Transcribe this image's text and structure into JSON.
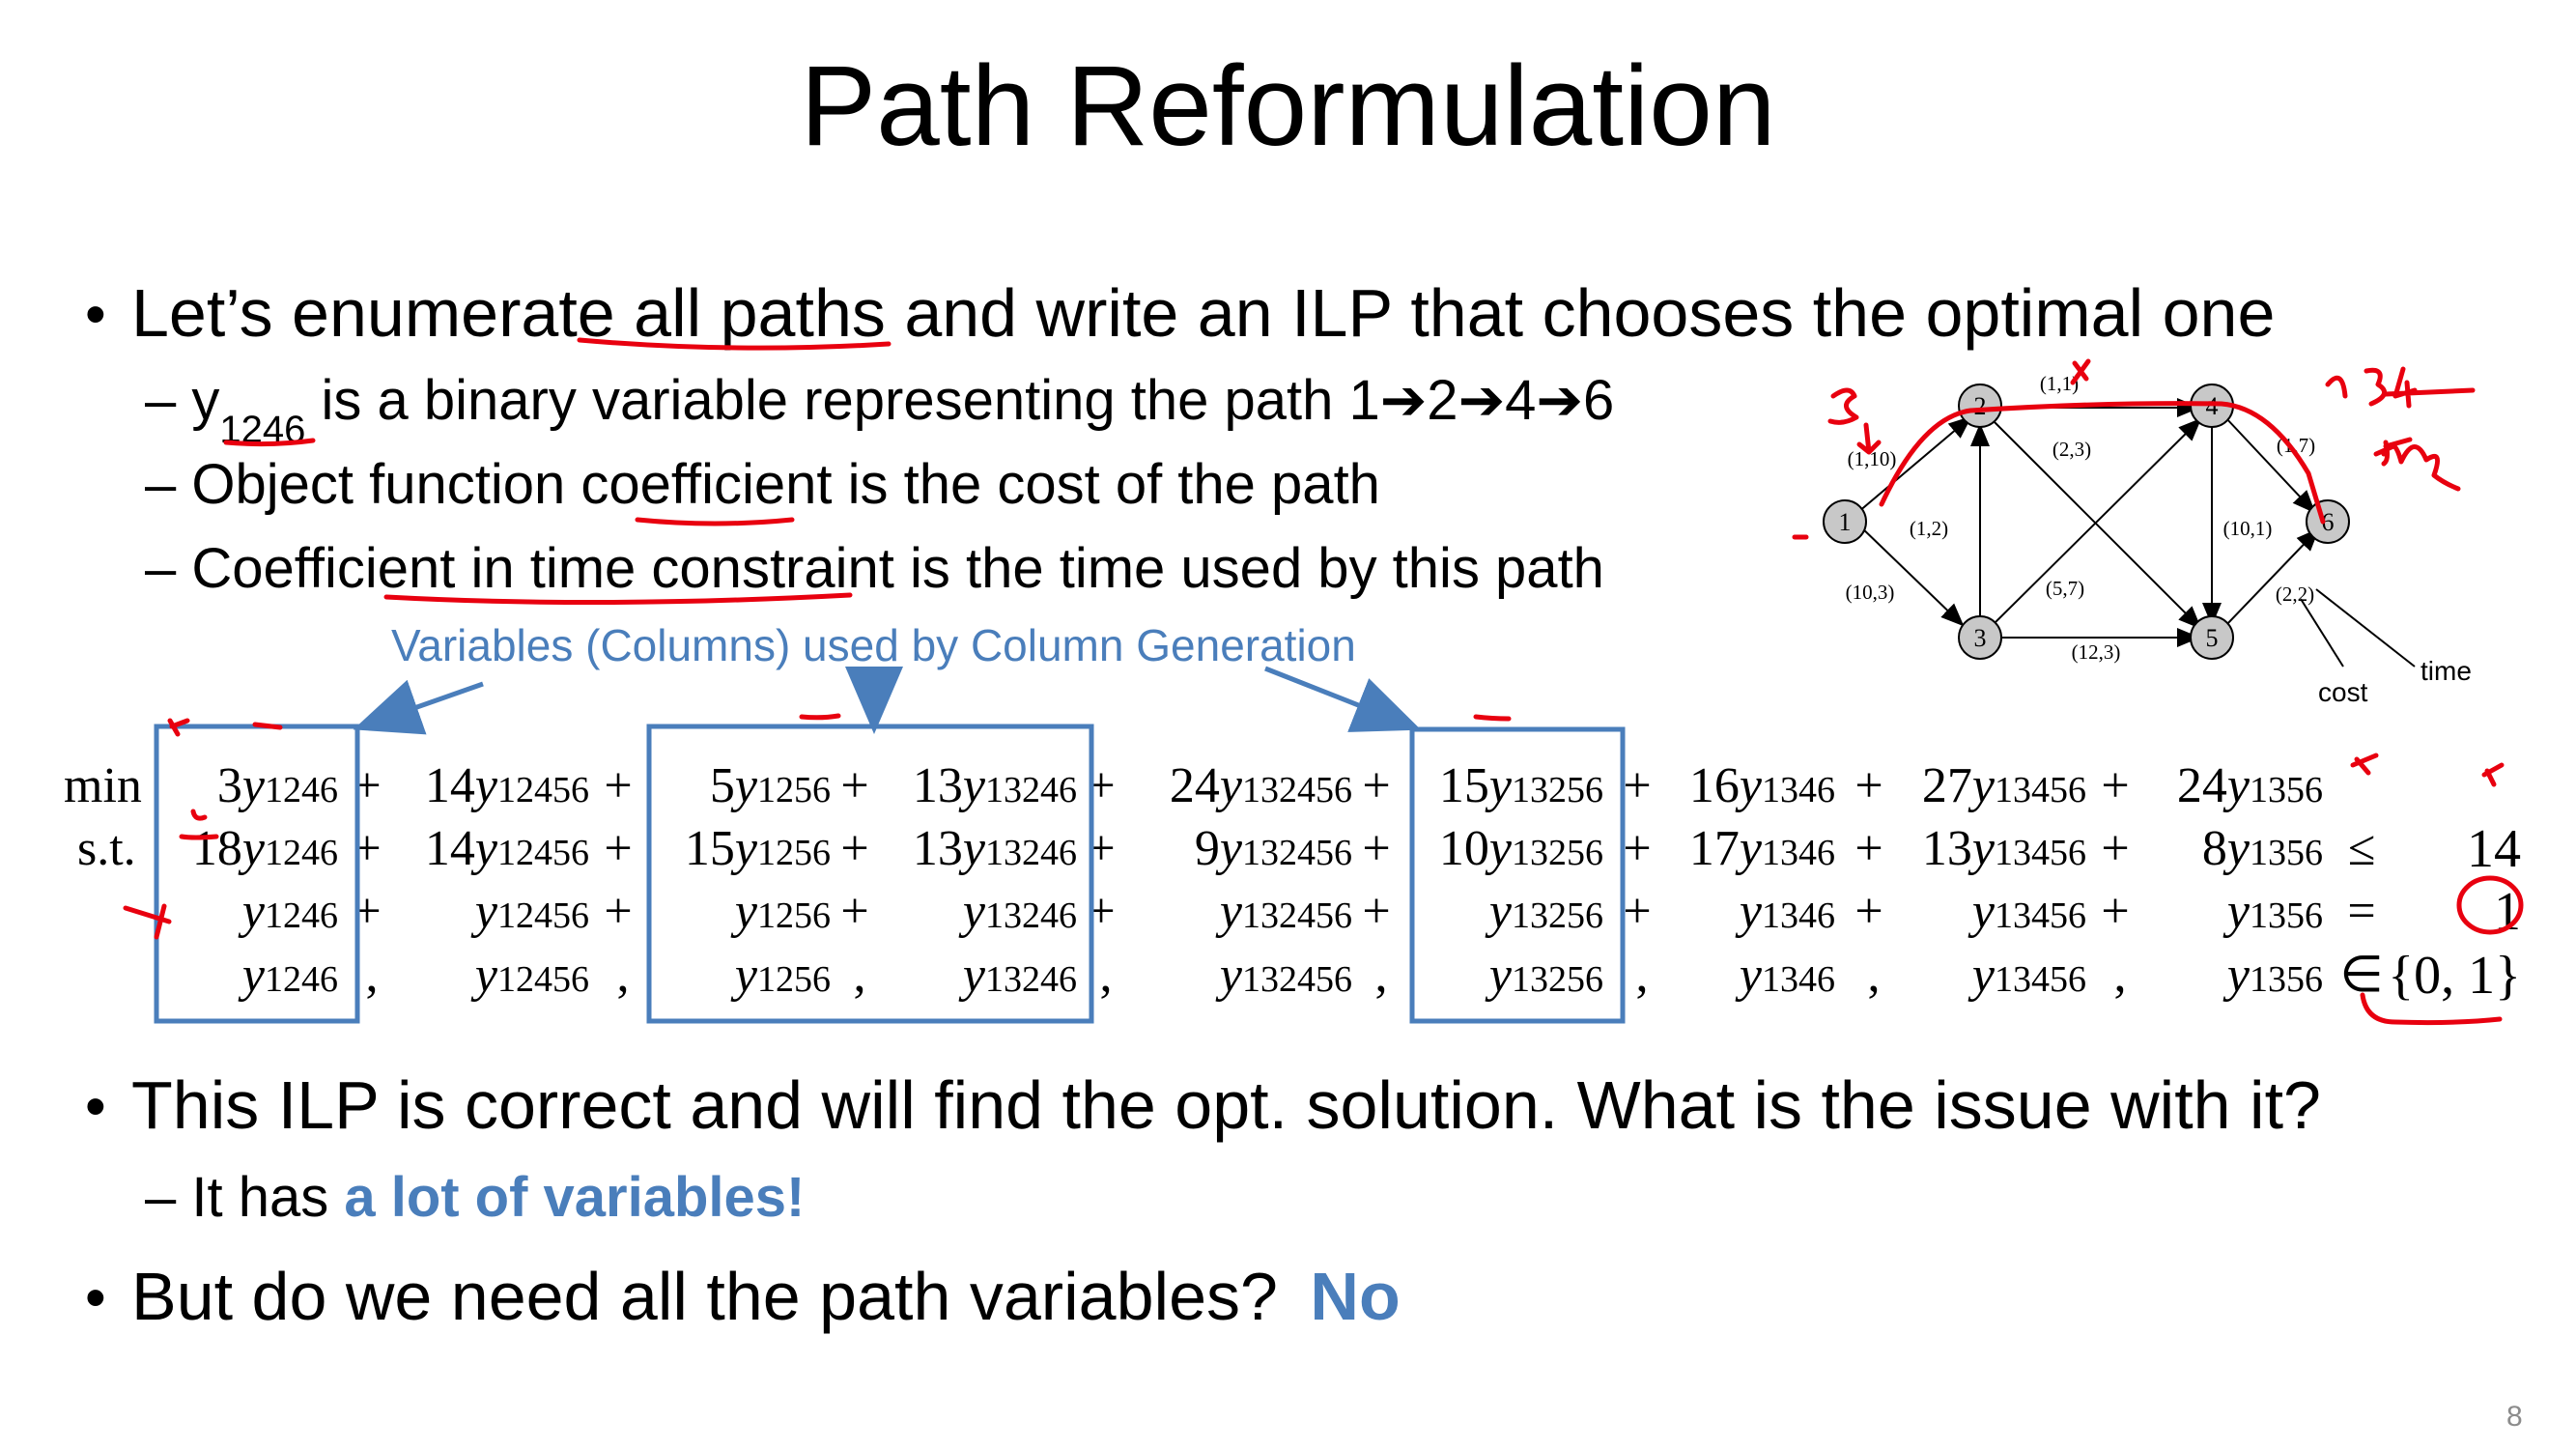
{
  "slide": {
    "title": "Path Reformulation",
    "page_number": "8",
    "bullet1": {
      "pre": "Let’s enumerate all paths and write an ILP that chooses the optimal one",
      "sub": [
        {
          "dash": "–",
          "var": "y",
          "subscript": "1246",
          "text": " is a binary variable representing the path 1➔2➔4➔6"
        },
        {
          "dash": "–",
          "text": "Object function coefficient is the cost of the path"
        },
        {
          "dash": "–",
          "text": "Coefficient in time constraint is the time used by this path"
        }
      ]
    },
    "annotation_label": "Variables (Columns) used by Column Generation",
    "bullet2": {
      "text": "This ILP is correct and will find the opt. solution. What is the issue with it?",
      "sub_pre": "– It has ",
      "sub_highlight": "a lot of variables!"
    },
    "bullet3": {
      "text": "But do we need all the path variables?",
      "answer": "No"
    },
    "colors": {
      "accent_blue": "#4a7ebb",
      "ink_red": "#e8000f",
      "node_gray": "#c8c8c8"
    }
  },
  "ilp": {
    "row_labels": [
      "min",
      "s.t.",
      "",
      ""
    ],
    "columns": [
      {
        "sub": "1246",
        "obj": "3",
        "time": "18"
      },
      {
        "sub": "12456",
        "obj": "14",
        "time": "14"
      },
      {
        "sub": "1256",
        "obj": "5",
        "time": "15"
      },
      {
        "sub": "13246",
        "obj": "13",
        "time": "13"
      },
      {
        "sub": "132456",
        "obj": "24",
        "time": "9"
      },
      {
        "sub": "13256",
        "obj": "15",
        "time": "10"
      },
      {
        "sub": "1346",
        "obj": "16",
        "time": "17"
      },
      {
        "sub": "13456",
        "obj": "27",
        "time": "13"
      },
      {
        "sub": "1356",
        "obj": "24",
        "time": "8"
      }
    ],
    "relations": [
      "",
      "≤",
      "=",
      "∈"
    ],
    "rhs": [
      "",
      "14",
      "1",
      "{0, 1}"
    ],
    "var_symbol": "y"
  },
  "graph": {
    "nodes": [
      "1",
      "2",
      "3",
      "4",
      "5",
      "6"
    ],
    "edge_labels": [
      "(1,10)",
      "(1,1)",
      "(2,3)",
      "(1,7)",
      "(1,2)",
      "(10,1)",
      "(10,3)",
      "(5,7)",
      "(2,2)",
      "(12,3)"
    ],
    "legend": {
      "cost": "cost",
      "time": "time"
    }
  }
}
